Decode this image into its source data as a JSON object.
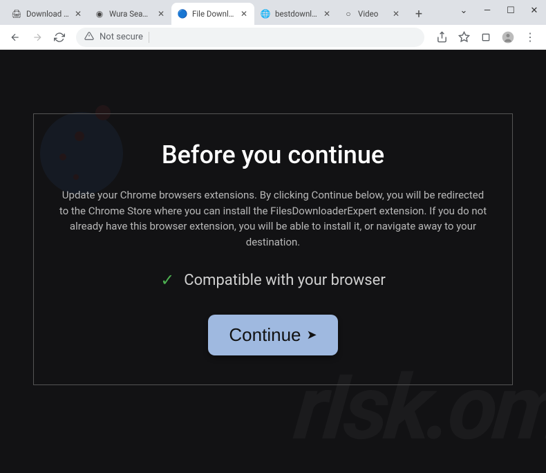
{
  "tabs": [
    {
      "title": "Download mu",
      "favicon": "🖨"
    },
    {
      "title": "Wura Season",
      "favicon": "◉"
    },
    {
      "title": "File Downloac",
      "favicon": "🔵",
      "active": true
    },
    {
      "title": "bestdownloac",
      "favicon": "🌐"
    },
    {
      "title": "Video",
      "favicon": "○"
    }
  ],
  "window": {
    "dropdown": "⌄",
    "minimize": "—",
    "maximize": "☐",
    "close": "✕"
  },
  "toolbar": {
    "back": "←",
    "forward": "→",
    "reload": "⟳",
    "security_label": "Not secure",
    "share": "➦",
    "star": "☆",
    "ext": "▭",
    "profile": "👤",
    "menu": "⋮",
    "newtab": "+"
  },
  "page": {
    "heading": "Before you continue",
    "body": "Update your Chrome browsers extensions. By clicking Continue below, you will be redirected to the Chrome Store where you can install the FilesDownloaderExpert extension. If you do not already have this browser extension, you will be able to install it, or navigate away to your destination.",
    "compat": "Compatible with your browser",
    "check": "✓",
    "continue": "Continue",
    "arrow": "➤",
    "watermark": "rIsk.om"
  }
}
